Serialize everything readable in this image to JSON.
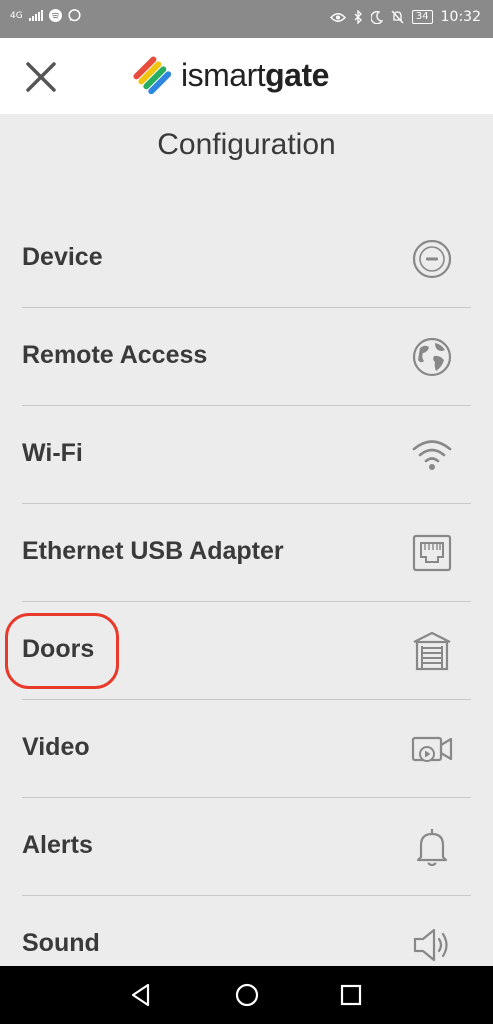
{
  "status_bar": {
    "network": "4G",
    "battery": "34",
    "time": "10:32"
  },
  "app_bar": {
    "logo_text_light": "ismart",
    "logo_text_bold": "gate"
  },
  "page": {
    "title": "Configuration"
  },
  "menu": {
    "items": [
      {
        "label": "Device",
        "icon": "device-icon"
      },
      {
        "label": "Remote Access",
        "icon": "globe-icon"
      },
      {
        "label": "Wi-Fi",
        "icon": "wifi-icon"
      },
      {
        "label": "Ethernet USB Adapter",
        "icon": "ethernet-icon"
      },
      {
        "label": "Doors",
        "icon": "garage-door-icon"
      },
      {
        "label": "Video",
        "icon": "video-camera-icon"
      },
      {
        "label": "Alerts",
        "icon": "bell-icon"
      },
      {
        "label": "Sound",
        "icon": "speaker-icon"
      }
    ]
  },
  "colors": {
    "status_bar": "#8a8a8a",
    "app_bar": "#ffffff",
    "background": "#ececec",
    "text": "#3a3a3a",
    "icon": "#888888",
    "highlight": "#e83a2a"
  }
}
